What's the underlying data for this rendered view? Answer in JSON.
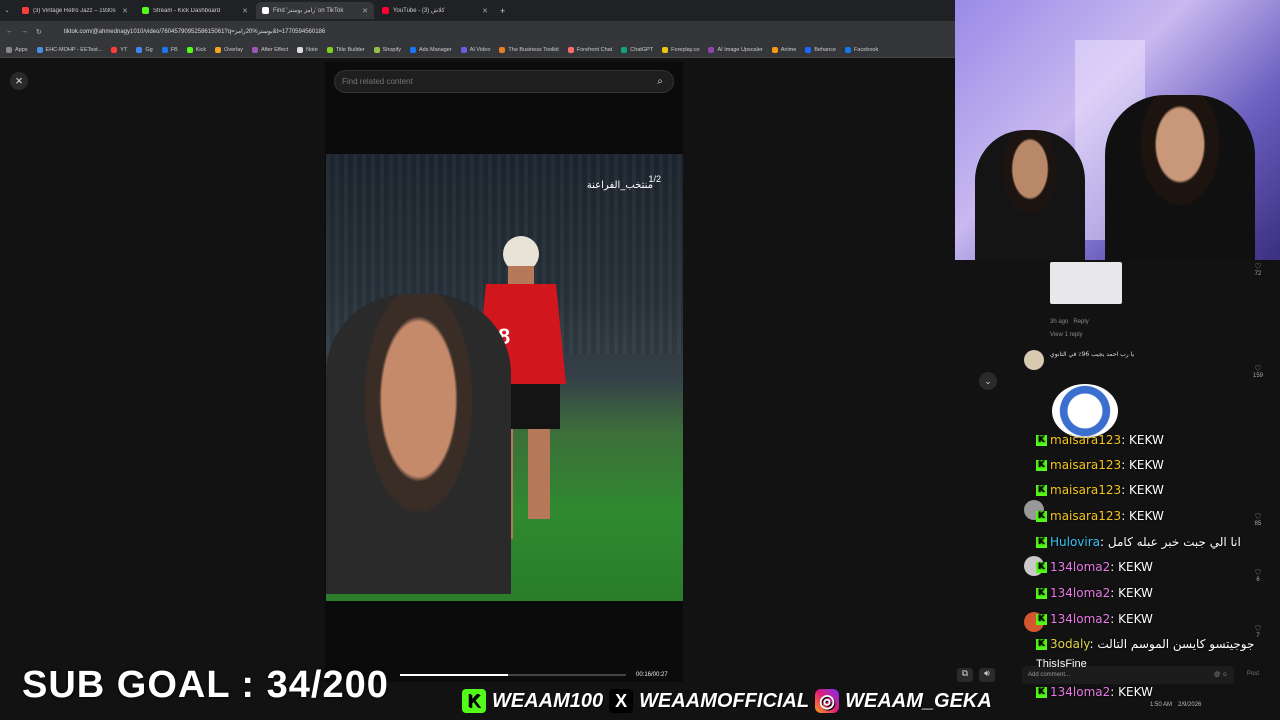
{
  "tabs": [
    {
      "title": "(3) Vintage Retro Jazz – 1930s",
      "color": "#ff3b3b"
    },
    {
      "title": "Stream - Kick Dashboard",
      "color": "#53fc18"
    },
    {
      "title": "Find 'رامز بوستر' on TikTok",
      "color": "#ffffff"
    },
    {
      "title": "YouTube - (3) كلاش",
      "color": "#ff0033"
    }
  ],
  "url": "tiktok.com/@ahmednagy1010/video/7604579095258615061?q=بوستر%20رامز&t=1770594560186",
  "bookmarks": [
    "Apps",
    "EHC-MOHP - EETest...",
    "YT",
    "Gg",
    "FB",
    "Kick",
    "Overlay",
    "After Effect",
    "Note",
    "Title Builder",
    "Shopify",
    "Ads Manager",
    "AI Video",
    "The Business Toolkit",
    "Forefront Chat",
    "ChatGPT",
    "Foreplay.co",
    "AI Image Upscaler",
    "Anime",
    "Behance",
    "Facebook"
  ],
  "search": {
    "placeholder": "Find related content"
  },
  "video": {
    "overlay_text": "منتخب_الفراعنة",
    "counter": "1/2",
    "time": "00:16/00:27",
    "progress": 0.48,
    "jersey_number": "8"
  },
  "stream_overlay": {
    "sub_goal": "SUB GOAL : 34/200",
    "kick": "WEAAM100",
    "x": "WEAAMOFFICIAL",
    "instagram": "WEAAM_GEKA"
  },
  "comments_meta": [
    {
      "text": "3h ago",
      "reply": "Reply"
    },
    {
      "text": "View 1 reply"
    },
    {
      "text": "يا رب احمد يجيب 96٪ في التانوي"
    }
  ],
  "likes": [
    "72",
    "159",
    "85",
    "6",
    "7"
  ],
  "chat": [
    {
      "user": "maisara123",
      "msg": "KEKW",
      "cls": "u1"
    },
    {
      "user": "maisara123",
      "msg": "KEKW",
      "cls": "u1"
    },
    {
      "user": "maisara123",
      "msg": "KEKW",
      "cls": "u1"
    },
    {
      "user": "maisara123",
      "msg": "KEKW",
      "cls": "u1"
    },
    {
      "user": "Hulovira",
      "msg": "انا الي جبت خبر عبله كامل",
      "cls": "u2"
    },
    {
      "user": "134loma2",
      "msg": "KEKW",
      "cls": "u3"
    },
    {
      "user": "134loma2",
      "msg": "KEKW",
      "cls": "u3"
    },
    {
      "user": "134loma2",
      "msg": "KEKW",
      "cls": "u3"
    },
    {
      "user": "3odaly",
      "msg": "جوجيتسو كايسن الموسم التالت",
      "cls": "u4"
    },
    {
      "user": "134loma2",
      "msg": "KEKW",
      "cls": "u3"
    }
  ],
  "chat_extra": "ThisIsFine",
  "comment_box": {
    "placeholder": "Add comment...",
    "post": "Post"
  },
  "clock": {
    "time": "1:50 AM",
    "date": "2/9/2026"
  }
}
